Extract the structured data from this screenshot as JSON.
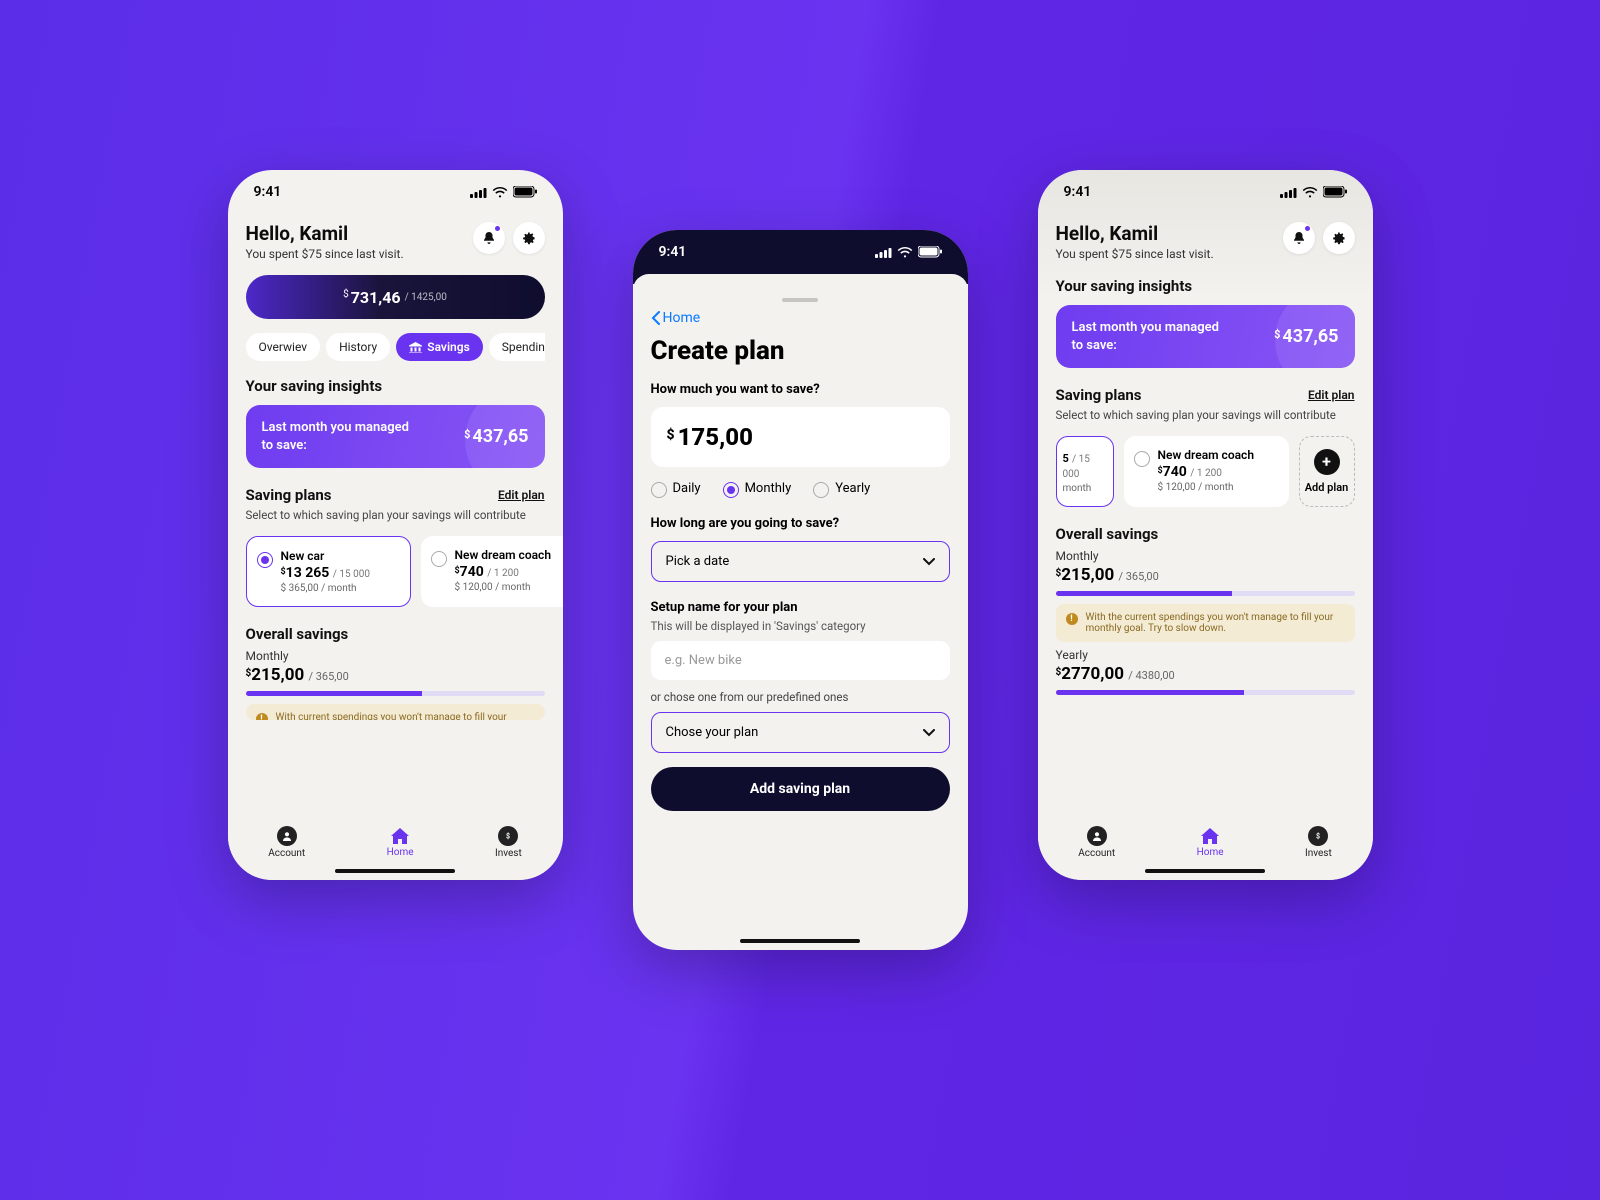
{
  "status": {
    "time": "9:41"
  },
  "greeting": {
    "hello": "Hello, Kamil",
    "sub": "You spent $75 since last visit."
  },
  "balance": {
    "currency": "$",
    "amount": "731,46",
    "of": "/ 1425,00"
  },
  "tabs": {
    "overview": "Overwiev",
    "history": "History",
    "savings": "Savings",
    "spending": "Spending"
  },
  "insights": {
    "title": "Your saving insights",
    "label": "Last month you managed to save:",
    "currency": "$",
    "amount": "437,65"
  },
  "plans": {
    "title": "Saving plans",
    "edit": "Edit plan",
    "sub": "Select to which saving plan your savings will contribute",
    "car": {
      "name": "New car",
      "cur": "$",
      "amount": "13 265",
      "of": "/ 15 000",
      "per": "$ 365,00 / month"
    },
    "coach": {
      "name": "New dream coach",
      "cur": "$",
      "amount": "740",
      "of": "/ 1 200",
      "per": "$ 120,00 / month"
    },
    "add": "Add plan"
  },
  "overall": {
    "title": "Overall savings",
    "monthlyLabel": "Monthly",
    "monthlyCur": "$",
    "monthlyAmount": "215,00",
    "monthlyOf": "/ 365,00",
    "yearlyLabel": "Yearly",
    "yearlyCur": "$",
    "yearlyAmount": "2770,00",
    "yearlyOf": "/ 4380,00",
    "warn": "With the current spendings you won't manage to fill your monthly goal. Try to slow down.",
    "warnCut": "With current spendings you won't manage to fill your"
  },
  "nav": {
    "account": "Account",
    "home": "Home",
    "invest": "Invest"
  },
  "create": {
    "back": "Home",
    "title": "Create plan",
    "q1": "How much you want to save?",
    "cur": "$",
    "amount": "175,00",
    "daily": "Daily",
    "monthly": "Monthly",
    "yearly": "Yearly",
    "q2": "How long are you going to save?",
    "pick": "Pick a date",
    "q3": "Setup name for your plan",
    "hint": "This will be displayed in 'Savings' category",
    "placeholder": "e.g. New bike",
    "or": "or chose one from our predefined ones",
    "choose": "Chose your plan",
    "cta": "Add saving plan"
  },
  "p3plan": {
    "small_of": "/ 15 000",
    "small_per": "month"
  }
}
